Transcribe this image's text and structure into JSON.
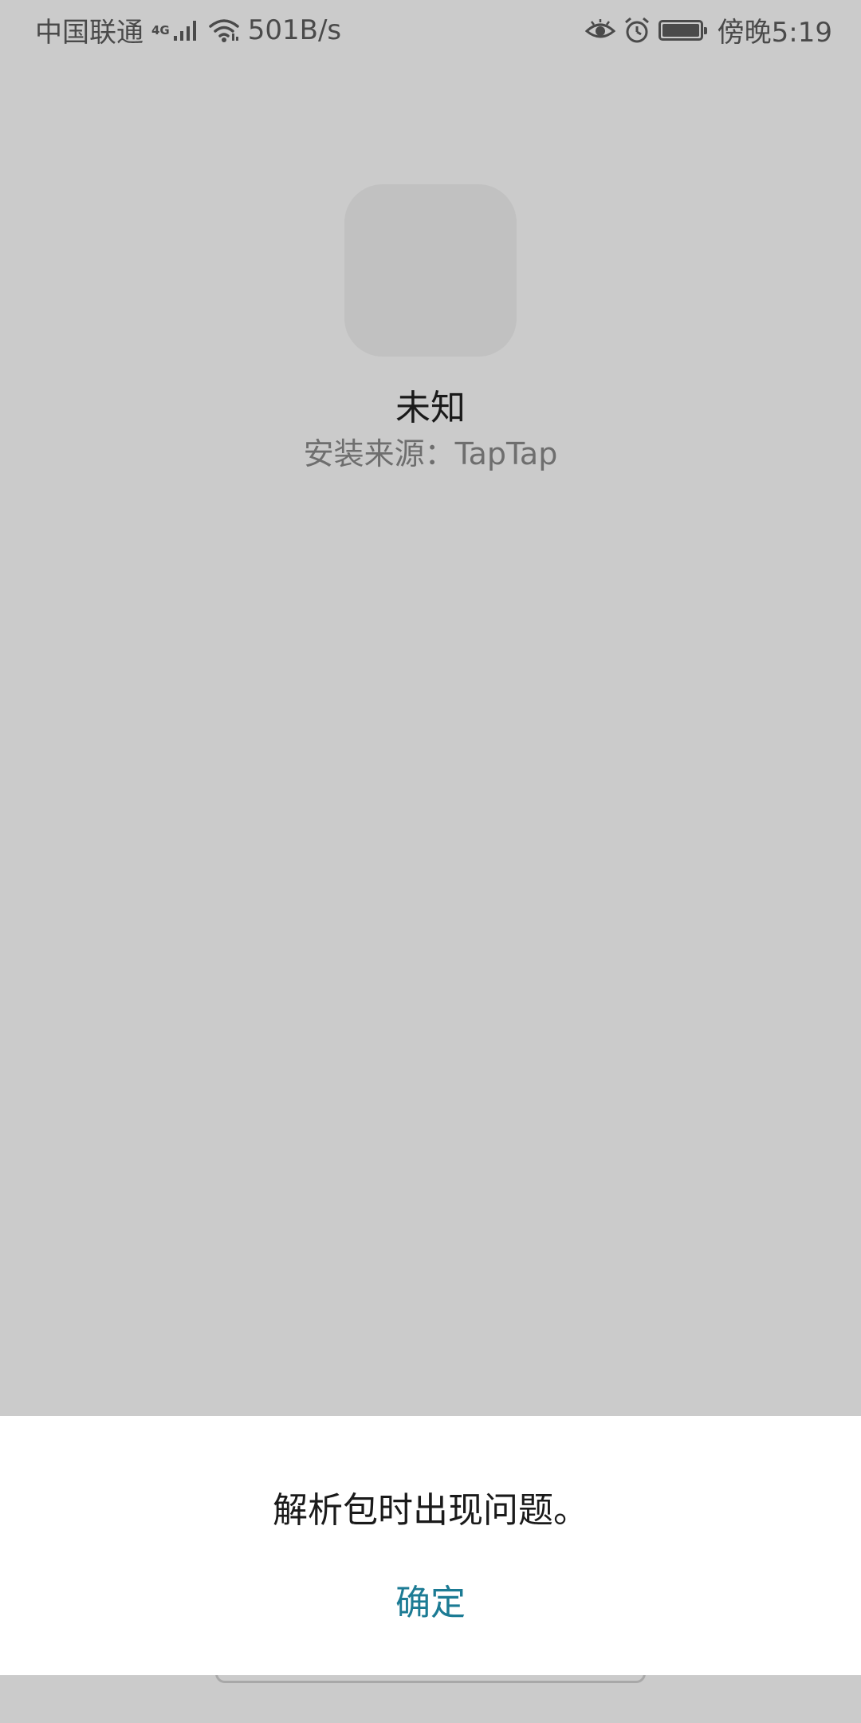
{
  "status_bar": {
    "carrier": "中国联通",
    "network_type": "4G",
    "speed": "501B/s",
    "time": "傍晚5:19",
    "icons": [
      "signal-icon",
      "wifi-icon",
      "eye-comfort-icon",
      "alarm-icon",
      "battery-icon"
    ],
    "battery_level": 1.0
  },
  "app": {
    "name": "未知",
    "install_source": "安装来源：TapTap"
  },
  "dialog": {
    "message": "解析包时出现问题。",
    "confirm_label": "确定",
    "accent_color": "#1c7b94"
  }
}
